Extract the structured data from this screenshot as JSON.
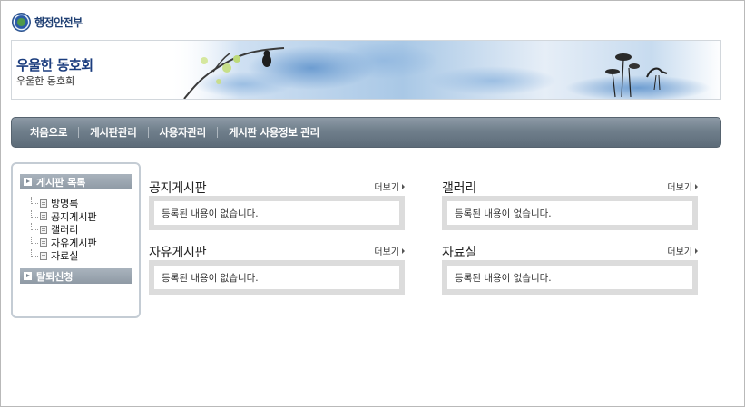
{
  "logo": {
    "text": "행정안전부"
  },
  "banner": {
    "title": "우울한 동호회",
    "subtitle": "우울한 동호회"
  },
  "nav": {
    "items": [
      "처음으로",
      "게시판관리",
      "사용자관리",
      "게시판 사용정보 관리"
    ]
  },
  "sidebar": {
    "section1": "게시판 목록",
    "items": [
      "방명록",
      "공지게시판",
      "갤러리",
      "자유게시판",
      "자료실"
    ],
    "section2": "탈퇴신청"
  },
  "boards": [
    {
      "title": "공지게시판",
      "more": "더보기",
      "empty": "등록된 내용이 없습니다."
    },
    {
      "title": "갤러리",
      "more": "더보기",
      "empty": "등록된 내용이 없습니다."
    },
    {
      "title": "자유게시판",
      "more": "더보기",
      "empty": "등록된 내용이 없습니다."
    },
    {
      "title": "자료실",
      "more": "더보기",
      "empty": "등록된 내용이 없습니다."
    }
  ],
  "colors": {
    "nav_bar": "#6f7e8b",
    "banner_title": "#1b3d7e",
    "board_frame": "#dcdcdc"
  }
}
